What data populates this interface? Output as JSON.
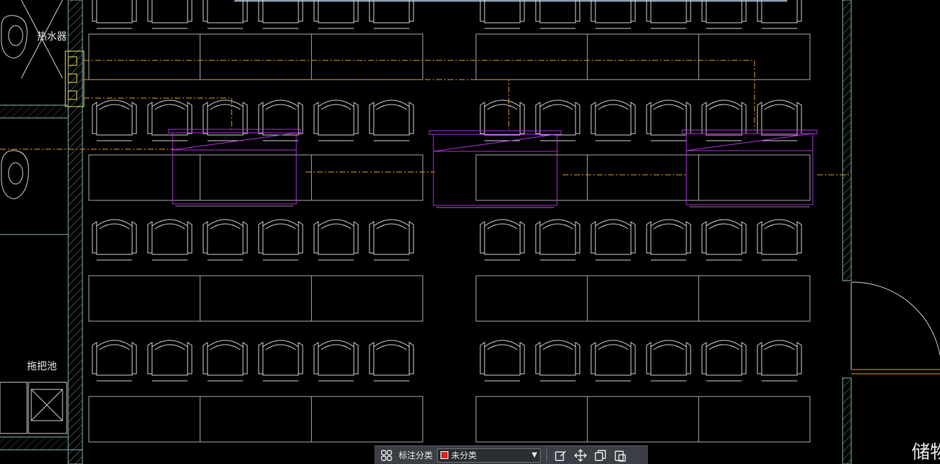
{
  "drawing": {
    "label_water_heater": "热水器",
    "label_mop_pool": "拖把池",
    "label_storage": "储物"
  },
  "toolbar": {
    "category_label": "标注分类",
    "category_value": "未分类",
    "swatch_color": "#e02020",
    "icons": [
      "grid-icon",
      "chevron-down-icon",
      "edit-icon",
      "move-icon",
      "copy-icon",
      "paste-icon"
    ]
  },
  "colors": {
    "background": "#000000",
    "linework": "#d0d0d0",
    "wall": "#7fb8b8",
    "hatch": "#8c8c8c",
    "pipe": "#e0a020",
    "equipment": "#b030e0",
    "fixture": "#e8e860"
  }
}
